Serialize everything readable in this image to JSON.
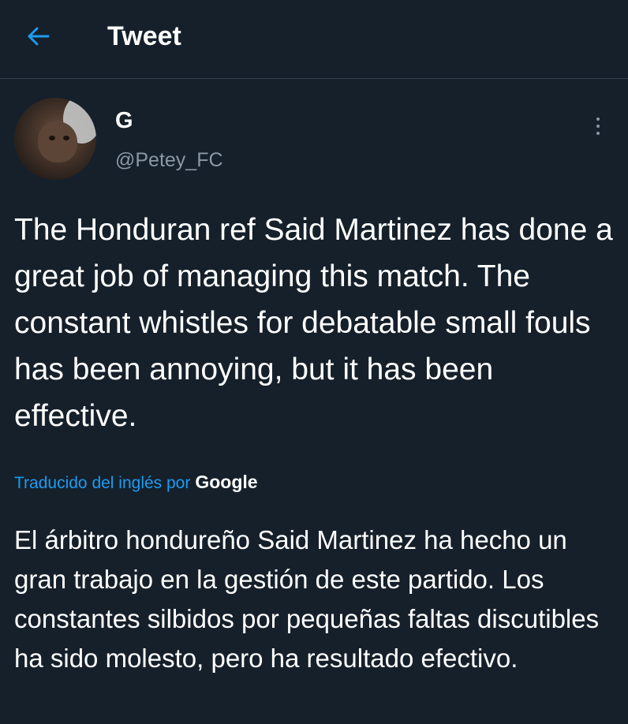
{
  "header": {
    "back_icon": "arrow-left-icon",
    "title": "Tweet",
    "accent_color": "#1d9bf0"
  },
  "tweet": {
    "author_name": "G",
    "author_handle": "@Petey_FC",
    "more_icon": "vertical-ellipsis-icon",
    "text": "The Honduran ref Said Martinez has done a great job of managing this match. The constant whistles for debatable small fouls has been annoying, but it has been effective.",
    "translation_label": "Traducido del inglés por",
    "translation_provider": "Google",
    "translated_text": "El árbitro hondureño Said Martinez ha hecho un gran trabajo en la gestión de este partido. Los constantes silbidos por pequeñas faltas discutibles ha sido molesto, pero ha resultado efectivo."
  },
  "colors": {
    "background": "#15202b",
    "secondary_text": "#8b98a5",
    "link": "#1d9bf0",
    "divider": "#2f3d4b"
  }
}
